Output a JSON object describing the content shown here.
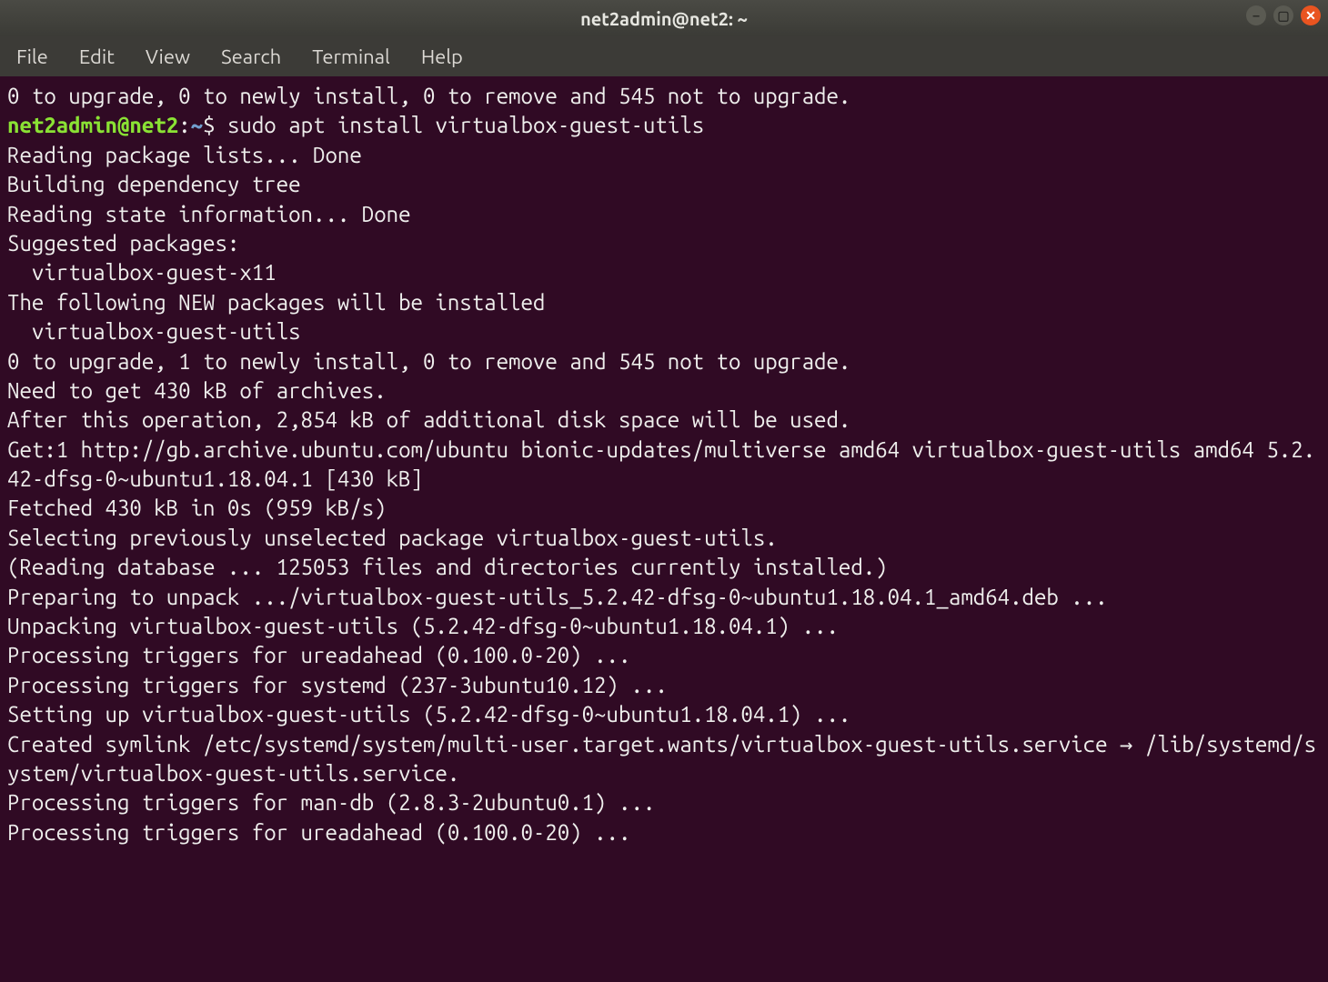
{
  "titlebar": {
    "title": "net2admin@net2: ~"
  },
  "menubar": {
    "items": [
      "File",
      "Edit",
      "View",
      "Search",
      "Terminal",
      "Help"
    ]
  },
  "prompt": {
    "user_host": "net2admin@net2",
    "path": "~",
    "symbol": "$",
    "command": "sudo apt install virtualbox-guest-utils"
  },
  "lines": {
    "pre_prompt": "0 to upgrade, 0 to newly install, 0 to remove and 545 not to upgrade.",
    "l01": "Reading package lists... Done",
    "l02": "Building dependency tree",
    "l03": "Reading state information... Done",
    "l04": "Suggested packages:",
    "l05": "  virtualbox-guest-x11",
    "l06": "The following NEW packages will be installed",
    "l07": "  virtualbox-guest-utils",
    "l08": "0 to upgrade, 1 to newly install, 0 to remove and 545 not to upgrade.",
    "l09": "Need to get 430 kB of archives.",
    "l10": "After this operation, 2,854 kB of additional disk space will be used.",
    "l11": "Get:1 http://gb.archive.ubuntu.com/ubuntu bionic-updates/multiverse amd64 virtualbox-guest-utils amd64 5.2.42-dfsg-0~ubuntu1.18.04.1 [430 kB]",
    "l12": "Fetched 430 kB in 0s (959 kB/s)",
    "l13": "Selecting previously unselected package virtualbox-guest-utils.",
    "l14": "(Reading database ... 125053 files and directories currently installed.)",
    "l15": "Preparing to unpack .../virtualbox-guest-utils_5.2.42-dfsg-0~ubuntu1.18.04.1_amd64.deb ...",
    "l16": "Unpacking virtualbox-guest-utils (5.2.42-dfsg-0~ubuntu1.18.04.1) ...",
    "l17": "Processing triggers for ureadahead (0.100.0-20) ...",
    "l18": "Processing triggers for systemd (237-3ubuntu10.12) ...",
    "l19": "Setting up virtualbox-guest-utils (5.2.42-dfsg-0~ubuntu1.18.04.1) ...",
    "l20": "Created symlink /etc/systemd/system/multi-user.target.wants/virtualbox-guest-utils.service → /lib/systemd/system/virtualbox-guest-utils.service.",
    "l21": "Processing triggers for man-db (2.8.3-2ubuntu0.1) ...",
    "l22": "Processing triggers for ureadahead (0.100.0-20) ..."
  },
  "window_controls": {
    "minimize": "–",
    "maximize": "▢",
    "close": "✕"
  }
}
